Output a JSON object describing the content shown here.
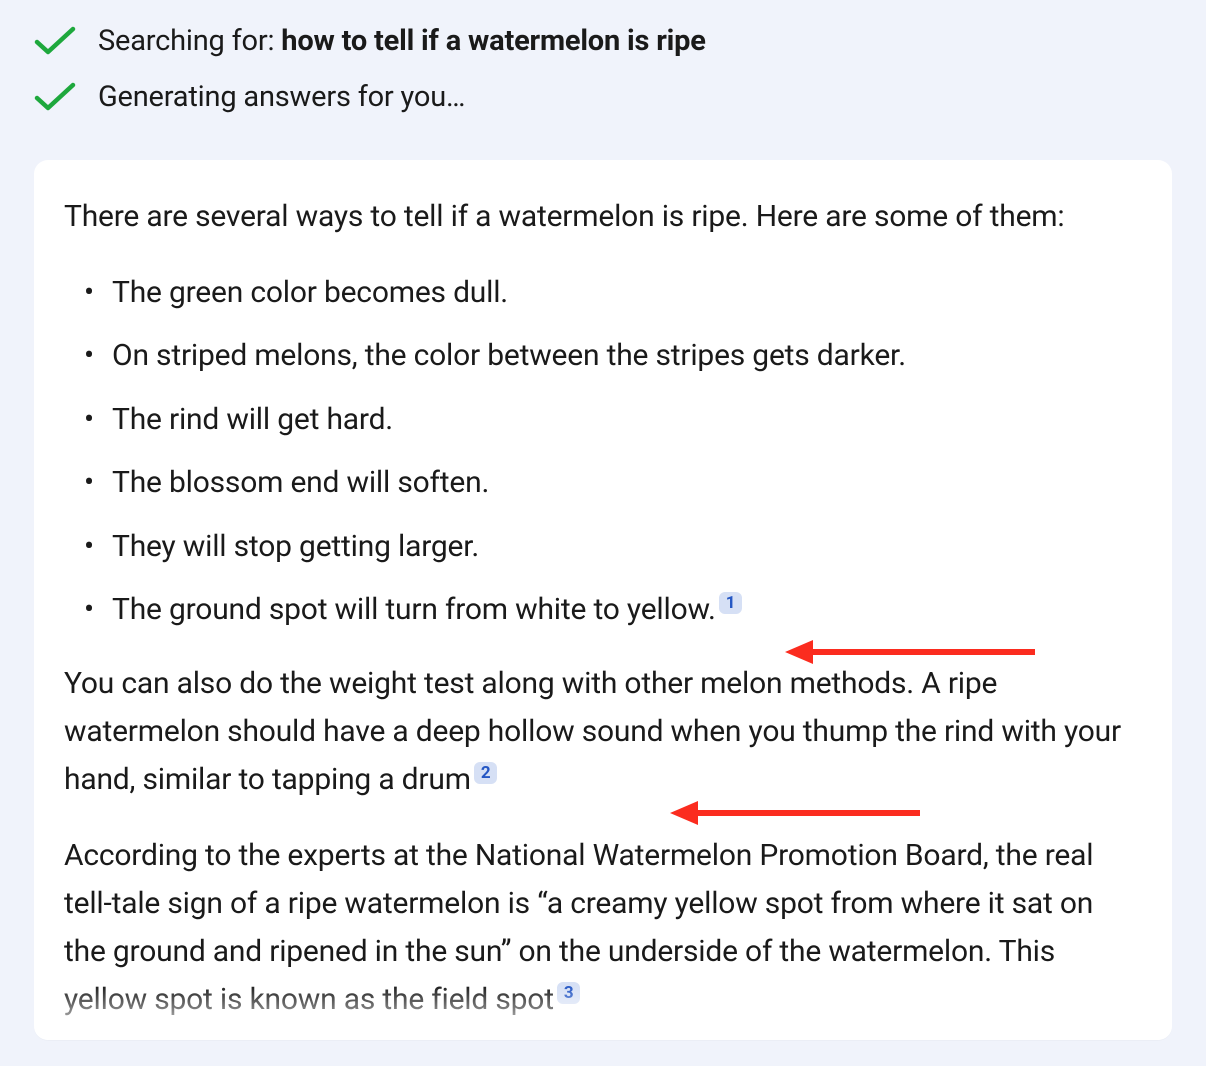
{
  "status": {
    "search_prefix": "Searching for: ",
    "search_query": "how to tell if a watermelon is ripe",
    "generating": "Generating answers for you…"
  },
  "answer": {
    "intro": "There are several ways to tell if a watermelon is ripe. Here are some of them:",
    "bullets": [
      "The green color becomes dull.",
      "On striped melons, the color between the stripes gets darker.",
      "The rind will get hard.",
      "The blossom end will soften.",
      "They will stop getting larger.",
      "The ground spot will turn from white to yellow."
    ],
    "citations": {
      "c1": "1",
      "c2": "2",
      "c3": "3"
    },
    "para2": "You can also do the weight test along with other melon methods. A ripe watermelon should have a deep hollow sound when you thump the rind with your hand, similar to tapping a drum",
    "para3a": "According to the experts at the National Watermelon Promotion Board, the real tell-tale sign of a ripe watermelon is “a creamy yellow spot from where it sat on the ground and ripened in the sun” on the underside of the watermelon. This yellow spot is known as the field spot"
  },
  "colors": {
    "check_green": "#1ea83d",
    "citation_bg": "#d6e0f5",
    "citation_fg": "#2557c4",
    "annotation_red": "#fb2c1f"
  }
}
